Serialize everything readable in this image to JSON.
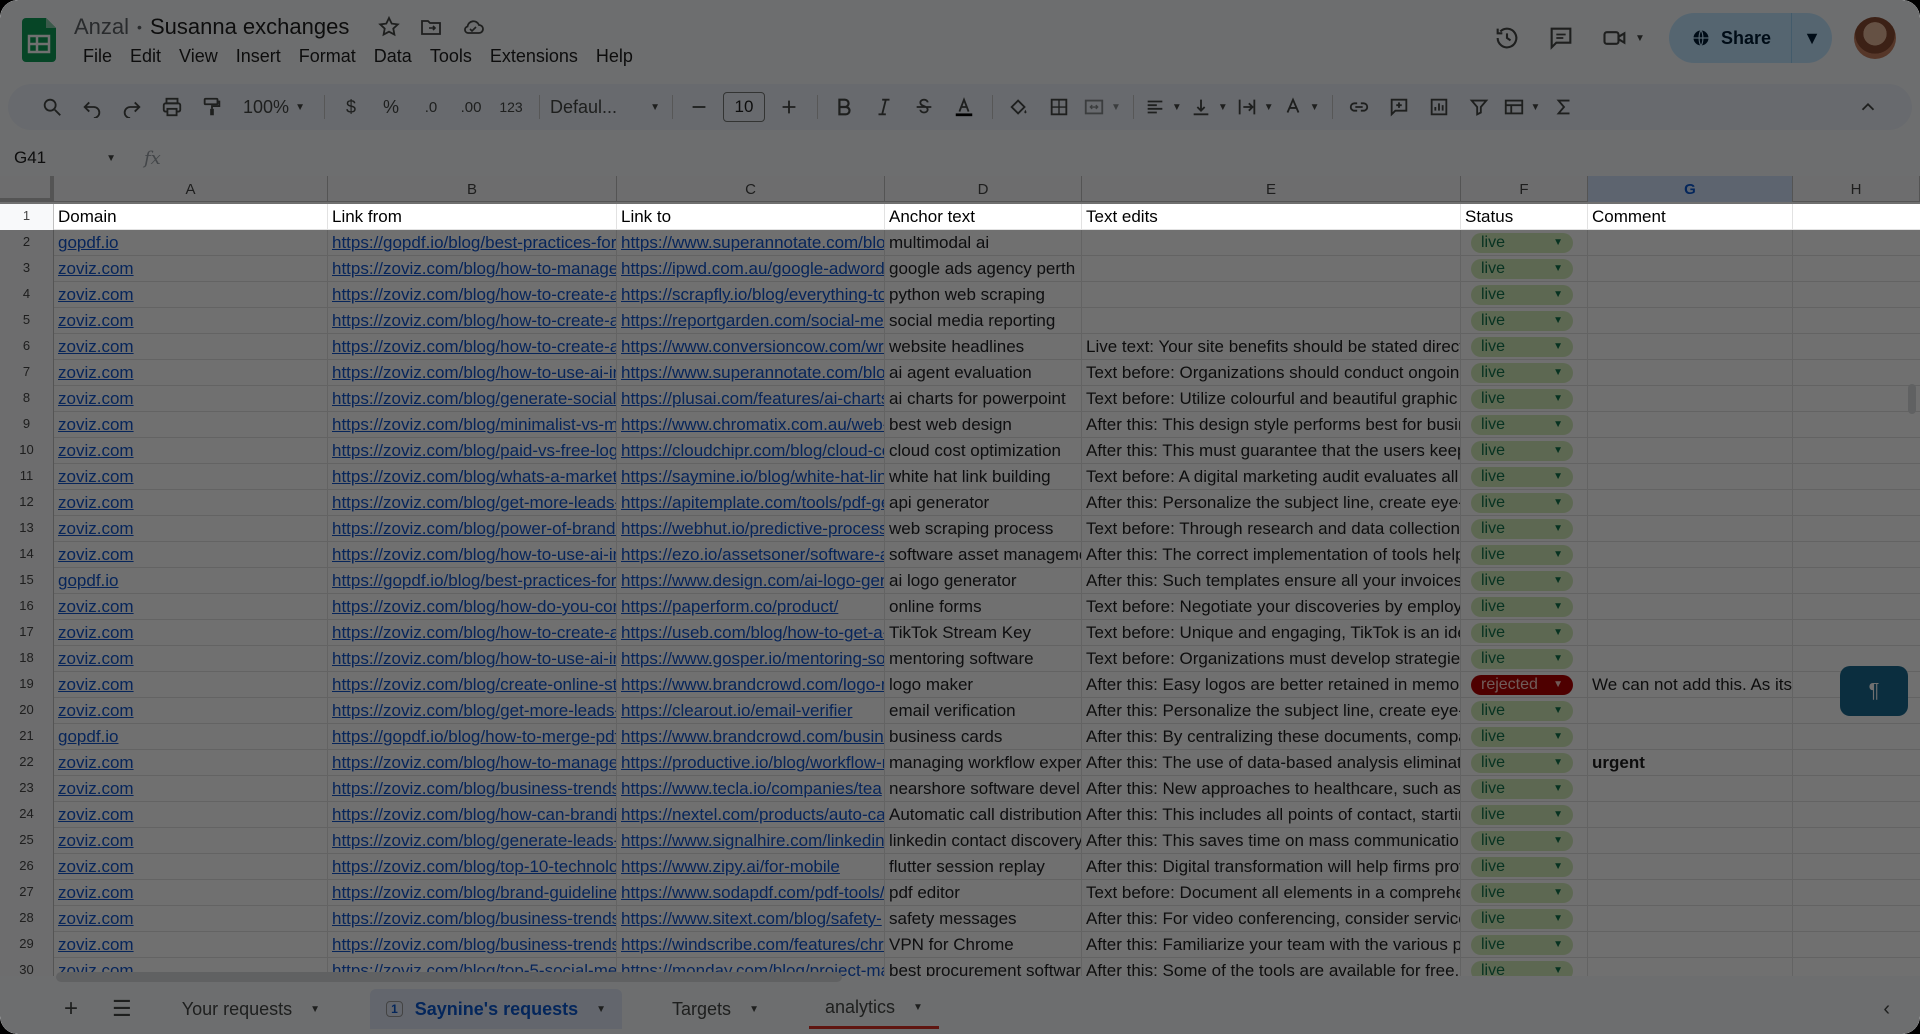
{
  "doc": {
    "owner": "Anzal",
    "title": "Susanna exchanges"
  },
  "menu": [
    "File",
    "Edit",
    "View",
    "Insert",
    "Format",
    "Data",
    "Tools",
    "Extensions",
    "Help"
  ],
  "share": {
    "label": "Share"
  },
  "toolbar": {
    "zoom": "100%",
    "currency": "$",
    "percent": "%",
    "dec_dec": ".0",
    "inc_dec": ".00",
    "number_format": "123",
    "font": "Defaul...",
    "font_size": "10"
  },
  "formula": {
    "namebox": "G41",
    "fx": "fx"
  },
  "columns": [
    "A",
    "B",
    "C",
    "D",
    "E",
    "F",
    "G",
    "H"
  ],
  "header": {
    "rownum": "1",
    "cells": [
      "Domain",
      "Link from",
      "Link to",
      "Anchor text",
      "Text edits",
      "Status",
      "Comment"
    ]
  },
  "rows": [
    {
      "n": "2",
      "domain": "gopdf.io",
      "from": "https://gopdf.io/blog/best-practices-for-",
      "to": "https://www.superannotate.com/blog",
      "anchor": "multimodal ai",
      "text": "",
      "status": "live",
      "comment": ""
    },
    {
      "n": "3",
      "domain": "zoviz.com",
      "from": "https://zoviz.com/blog/how-to-manage-",
      "to": "https://ipwd.com.au/google-adwords-",
      "anchor": "google ads agency perth",
      "text": "",
      "status": "live",
      "comment": ""
    },
    {
      "n": "4",
      "domain": "zoviz.com",
      "from": "https://zoviz.com/blog/how-to-create-a-",
      "to": "https://scrapfly.io/blog/everything-to-",
      "anchor": "python web scraping",
      "text": "",
      "status": "live",
      "comment": ""
    },
    {
      "n": "5",
      "domain": "zoviz.com",
      "from": "https://zoviz.com/blog/how-to-create-a-",
      "to": "https://reportgarden.com/social-media-",
      "anchor": "social media reporting",
      "text": "",
      "status": "live",
      "comment": ""
    },
    {
      "n": "6",
      "domain": "zoviz.com",
      "from": "https://zoviz.com/blog/how-to-create-a-",
      "to": "https://www.conversioncow.com/writ",
      "anchor": "website headlines",
      "text": "Live text: Your site benefits should be stated directly",
      "status": "live",
      "comment": ""
    },
    {
      "n": "7",
      "domain": "zoviz.com",
      "from": "https://zoviz.com/blog/how-to-use-ai-in",
      "to": "https://www.superannotate.com/blog",
      "anchor": "ai agent evaluation",
      "text": "Text before: Organizations should conduct ongoing",
      "status": "live",
      "comment": ""
    },
    {
      "n": "8",
      "domain": "zoviz.com",
      "from": "https://zoviz.com/blog/generate-social-",
      "to": "https://plusai.com/features/ai-charts",
      "anchor": "ai charts for powerpoint",
      "text": "Text before: Utilize colourful and beautiful graphic in",
      "status": "live",
      "comment": ""
    },
    {
      "n": "9",
      "domain": "zoviz.com",
      "from": "https://zoviz.com/blog/minimalist-vs-ma",
      "to": "https://www.chromatix.com.au/web-",
      "anchor": "best web design",
      "text": "After this: This design style performs best for busin",
      "status": "live",
      "comment": ""
    },
    {
      "n": "10",
      "domain": "zoviz.com",
      "from": "https://zoviz.com/blog/paid-vs-free-logo",
      "to": "https://cloudchipr.com/blog/cloud-co",
      "anchor": "cloud cost optimization",
      "text": "After this: This must guarantee that the users keep",
      "status": "live",
      "comment": ""
    },
    {
      "n": "11",
      "domain": "zoviz.com",
      "from": "https://zoviz.com/blog/whats-a-marketi",
      "to": "https://saymine.io/blog/white-hat-link",
      "anchor": "white hat link building",
      "text": "Text before: A digital marketing audit evaluates all c",
      "status": "live",
      "comment": ""
    },
    {
      "n": "12",
      "domain": "zoviz.com",
      "from": "https://zoviz.com/blog/get-more-leads-",
      "to": "https://apitemplate.com/tools/pdf-ge",
      "anchor": "api generator",
      "text": "After this: Personalize the subject line, create eye-c",
      "status": "live",
      "comment": ""
    },
    {
      "n": "13",
      "domain": "zoviz.com",
      "from": "https://zoviz.com/blog/power-of-brand-",
      "to": "https://webhut.io/predictive-process",
      "anchor": "web scraping process",
      "text": "Text before: Through research and data collection,",
      "status": "live",
      "comment": ""
    },
    {
      "n": "14",
      "domain": "zoviz.com",
      "from": "https://zoviz.com/blog/how-to-use-ai-in",
      "to": "https://ezo.io/assetsoner/software-a",
      "anchor": "software asset manageme",
      "text": "After this: The correct implementation of tools helps",
      "status": "live",
      "comment": ""
    },
    {
      "n": "15",
      "domain": "gopdf.io",
      "from": "https://gopdf.io/blog/best-practices-for-",
      "to": "https://www.design.com/ai-logo-gen",
      "anchor": "ai logo generator",
      "text": "After this: Such templates ensure all your invoices n",
      "status": "live",
      "comment": ""
    },
    {
      "n": "16",
      "domain": "zoviz.com",
      "from": "https://zoviz.com/blog/how-do-you-con",
      "to": "https://paperform.co/product/",
      "anchor": "online forms",
      "text": "Text before: Negotiate your discoveries by employin",
      "status": "live",
      "comment": ""
    },
    {
      "n": "17",
      "domain": "zoviz.com",
      "from": "https://zoviz.com/blog/how-to-create-a-",
      "to": "https://useb.com/blog/how-to-get-a-t",
      "anchor": "TikTok Stream Key",
      "text": "Text before: Unique and engaging, TikTok is an idea",
      "status": "live",
      "comment": ""
    },
    {
      "n": "18",
      "domain": "zoviz.com",
      "from": "https://zoviz.com/blog/how-to-use-ai-in",
      "to": "https://www.gosper.io/mentoring-soft",
      "anchor": "mentoring software",
      "text": "Text before: Organizations must develop strategies",
      "status": "live",
      "comment": ""
    },
    {
      "n": "19",
      "domain": "zoviz.com",
      "from": "https://zoviz.com/blog/create-online-sto",
      "to": "https://www.brandcrowd.com/logo-m",
      "anchor": "logo maker",
      "text": "After this: Easy logos are better retained in memory",
      "status": "rejected",
      "comment": "We can not add this. As its direct competitor"
    },
    {
      "n": "20",
      "domain": "zoviz.com",
      "from": "https://zoviz.com/blog/get-more-leads-",
      "to": "https://clearout.io/email-verifier",
      "anchor": "email verification",
      "text": "After this: Personalize the subject line, create eye-c",
      "status": "live",
      "comment": ""
    },
    {
      "n": "21",
      "domain": "gopdf.io",
      "from": "https://gopdf.io/blog/how-to-merge-pdf",
      "to": "https://www.brandcrowd.com/busine",
      "anchor": "business cards",
      "text": "After this: By centralizing these documents, compa",
      "status": "live",
      "comment": ""
    },
    {
      "n": "22",
      "domain": "zoviz.com",
      "from": "https://zoviz.com/blog/how-to-manage-",
      "to": "https://productive.io/blog/workflow-m",
      "anchor": "managing workflow experi",
      "text": "After this: The use of data-based analysis eliminates",
      "status": "live",
      "comment": "urgent"
    },
    {
      "n": "23",
      "domain": "zoviz.com",
      "from": "https://zoviz.com/blog/business-trends",
      "to": "https://www.tecla.io/companies/tea",
      "anchor": "nearshore software devel",
      "text": "After this: New approaches to healthcare, such as r",
      "status": "live",
      "comment": ""
    },
    {
      "n": "24",
      "domain": "zoviz.com",
      "from": "https://zoviz.com/blog/how-can-brandi",
      "to": "https://nextel.com/products/auto-cal",
      "anchor": "Automatic call distribution",
      "text": "After this: This includes all points of contact, startin",
      "status": "live",
      "comment": ""
    },
    {
      "n": "25",
      "domain": "zoviz.com",
      "from": "https://zoviz.com/blog/generate-leads-",
      "to": "https://www.signalhire.com/linkedin-",
      "anchor": "linkedin contact discovery",
      "text": "After this: This saves time on mass communication",
      "status": "live",
      "comment": ""
    },
    {
      "n": "26",
      "domain": "zoviz.com",
      "from": "https://zoviz.com/blog/top-10-technolo",
      "to": "https://www.zipy.ai/for-mobile",
      "anchor": "flutter session replay",
      "text": "After this: Digital transformation will help firms prov",
      "status": "live",
      "comment": ""
    },
    {
      "n": "27",
      "domain": "zoviz.com",
      "from": "https://zoviz.com/blog/brand-guideline",
      "to": "https://www.sodapdf.com/pdf-tools/",
      "anchor": "pdf editor",
      "text": "Text before: Document all elements in a comprehen",
      "status": "live",
      "comment": ""
    },
    {
      "n": "28",
      "domain": "zoviz.com",
      "from": "https://zoviz.com/blog/business-trends",
      "to": "https://www.sitext.com/blog/safety-",
      "anchor": "safety messages",
      "text": "After this: For video conferencing, consider services",
      "status": "live",
      "comment": ""
    },
    {
      "n": "29",
      "domain": "zoviz.com",
      "from": "https://zoviz.com/blog/business-trends",
      "to": "https://windscribe.com/features/chro",
      "anchor": "VPN for Chrome",
      "text": "After this: Familiarize your team with the various ph",
      "status": "live",
      "comment": ""
    },
    {
      "n": "30",
      "domain": "zoviz.com",
      "from": "https://zoviz.com/blog/top-5-social-me",
      "to": "https://monday.com/blog/project-ma",
      "anchor": "best procurement software",
      "text": "After this: Some of the tools are available for free, a",
      "status": "live",
      "comment": ""
    }
  ],
  "tabs": [
    {
      "label": "Your requests",
      "badge": ""
    },
    {
      "label": "Saynine's requests",
      "badge": "1"
    },
    {
      "label": "Targets",
      "badge": ""
    },
    {
      "label": "analytics",
      "badge": ""
    }
  ],
  "colors": {
    "accent": "#0b57d0",
    "live_chip": "#d4edbc",
    "rejected_chip": "#b10202",
    "link": "#1155cc"
  }
}
